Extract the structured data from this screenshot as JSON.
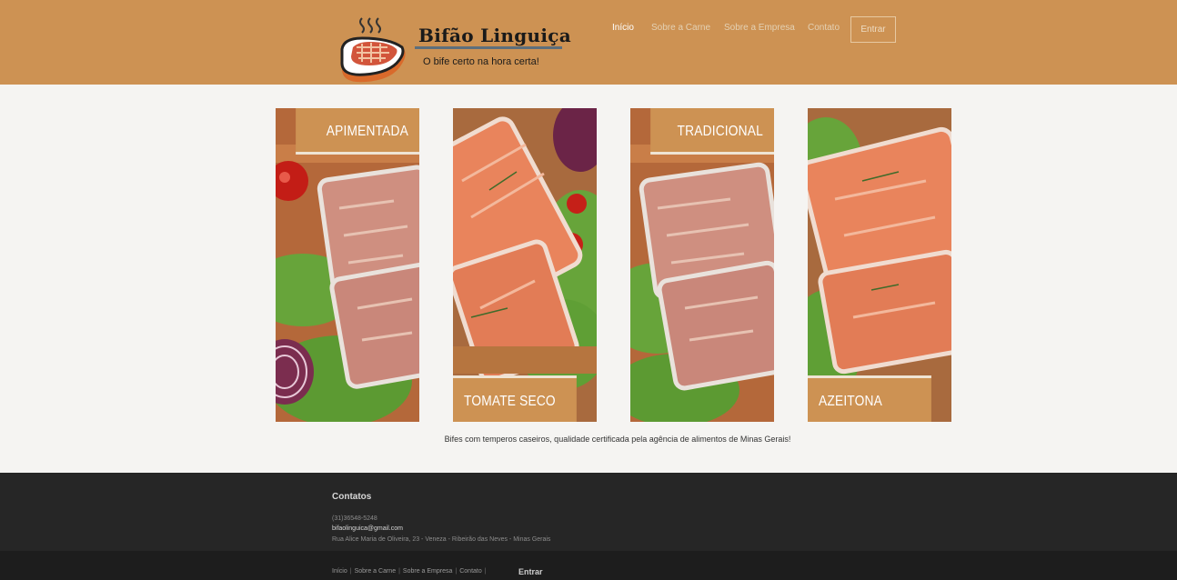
{
  "header": {
    "logo_title": "Bifão Linguiça",
    "logo_subtitle": "O bife certo na hora certa!",
    "nav": [
      {
        "label": "Início"
      },
      {
        "label": "Sobre a Carne"
      },
      {
        "label": "Sobre a Empresa"
      },
      {
        "label": "Contato"
      }
    ],
    "login_label": "Entrar"
  },
  "products": [
    {
      "label": "APIMENTADA"
    },
    {
      "label": "TOMATE SECO"
    },
    {
      "label": "TRADICIONAL"
    },
    {
      "label": "AZEITONA"
    }
  ],
  "tagline": "Bifes com temperos caseiros, qualidade certificada pela agência de alimentos de Minas Gerais!",
  "footer": {
    "title": "Contatos",
    "phone": "(31)36548-5248",
    "email": "bifaolinguica@gmail.com",
    "address": "Rua Alice Maria de Oliveira, 23 - Veneza - Ribeirão das Neves - Minas Gerais",
    "nav": [
      {
        "label": "Início"
      },
      {
        "label": "Sobre a Carne"
      },
      {
        "label": "Sobre a Empresa"
      },
      {
        "label": "Contato"
      }
    ],
    "nav_separator": "|",
    "login_label": "Entrar"
  },
  "colors": {
    "brand": "#cd9253",
    "footer": "#262626",
    "bottom_bar": "#1d1d1d",
    "page_bg": "#f5f4f2"
  },
  "icons": {
    "logo": "steak-icon"
  }
}
